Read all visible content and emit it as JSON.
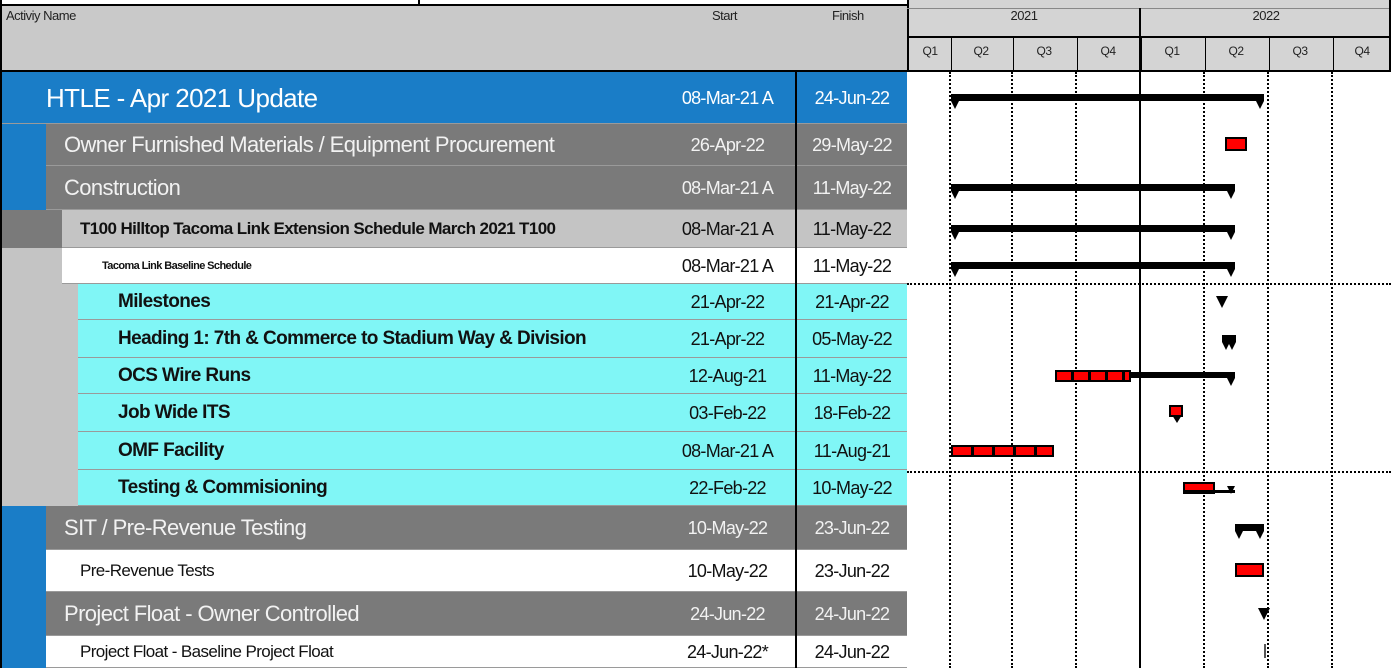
{
  "columns": {
    "activity_name": "Activiy Name",
    "start": "Start",
    "finish": "Finish"
  },
  "timeline": {
    "years": [
      "2021",
      "2022"
    ],
    "quarters": [
      "Q1",
      "Q2",
      "Q3",
      "Q4",
      "Q1",
      "Q2",
      "Q3",
      "Q4"
    ]
  },
  "colors": {
    "project_row": "#1a7dc7",
    "group_row": "#7a7a7a",
    "subgroup_row": "#c4c4c4",
    "activity_row": "#80f6f6",
    "critical_bar": "#ff0000",
    "summary_bar": "#000000"
  },
  "rows": [
    {
      "name": "HTLE - Apr 2021 Update",
      "start": "08-Mar-21 A",
      "finish": "24-Jun-22",
      "level": "project"
    },
    {
      "name": "Owner Furnished Materials / Equipment Procurement",
      "start": "26-Apr-22",
      "finish": "29-May-22",
      "level": "group"
    },
    {
      "name": "Construction",
      "start": "08-Mar-21 A",
      "finish": "11-May-22",
      "level": "group"
    },
    {
      "name": "T100 Hilltop Tacoma Link Extension Schedule March 2021 T100",
      "start": "08-Mar-21 A",
      "finish": "11-May-22",
      "level": "subgroup"
    },
    {
      "name": "Tacoma Link Baseline Schedule",
      "start": "08-Mar-21 A",
      "finish": "11-May-22",
      "level": "baseline"
    },
    {
      "name": "Milestones",
      "start": "21-Apr-22",
      "finish": "21-Apr-22",
      "level": "activity"
    },
    {
      "name": "Heading 1: 7th & Commerce to Stadium Way & Division",
      "start": "21-Apr-22",
      "finish": "05-May-22",
      "level": "activity"
    },
    {
      "name": "OCS Wire Runs",
      "start": "12-Aug-21",
      "finish": "11-May-22",
      "level": "activity"
    },
    {
      "name": "Job Wide ITS",
      "start": "03-Feb-22",
      "finish": "18-Feb-22",
      "level": "activity"
    },
    {
      "name": "OMF Facility",
      "start": "08-Mar-21 A",
      "finish": "11-Aug-21",
      "level": "activity"
    },
    {
      "name": "Testing & Commisioning",
      "start": "22-Feb-22",
      "finish": "10-May-22",
      "level": "activity"
    },
    {
      "name": "SIT / Pre-Revenue Testing",
      "start": "10-May-22",
      "finish": "23-Jun-22",
      "level": "group"
    },
    {
      "name": "Pre-Revenue Tests",
      "start": "10-May-22",
      "finish": "23-Jun-22",
      "level": "detail"
    },
    {
      "name": "Project Float - Owner Controlled",
      "start": "24-Jun-22",
      "finish": "24-Jun-22",
      "level": "group"
    },
    {
      "name": "Project Float - Baseline Project Float",
      "start": "24-Jun-22*",
      "finish": "24-Jun-22",
      "level": "detail"
    }
  ]
}
